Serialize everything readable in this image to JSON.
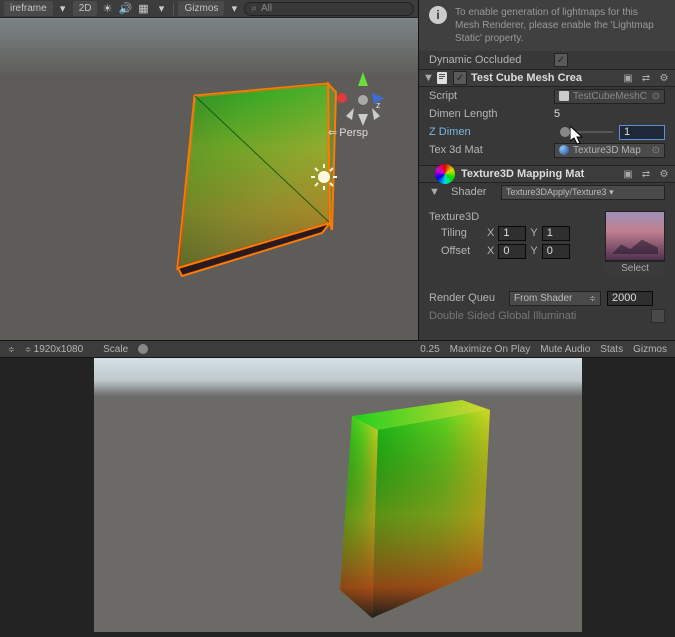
{
  "scene_toolbar": {
    "shading": "ireframe",
    "mode_2d": "2D",
    "gizmos_label": "Gizmos",
    "search_prefix": "All"
  },
  "inspector": {
    "lightmap_info": "To enable generation of lightmaps for this Mesh Renderer, please enable the 'Lightmap Static' property.",
    "dynamic_occluded": {
      "label": "Dynamic Occluded",
      "checked": true
    },
    "script_component": {
      "title": "Test Cube Mesh Crea",
      "enabled": true,
      "fields": {
        "script": {
          "label": "Script",
          "value": "TestCubeMeshC"
        },
        "dimen_length": {
          "label": "Dimen Length",
          "value": "5"
        },
        "z_dimen": {
          "label": "Z Dimen",
          "value": "1"
        },
        "tex_3d_mat": {
          "label": "Tex 3d Mat",
          "value": "Texture3D Map"
        }
      }
    },
    "material": {
      "title": "Texture3D Mapping Mat",
      "shader_label": "Shader",
      "shader_value": "Texture3DApply/Texture3",
      "texture_label": "Texture3D",
      "tiling": {
        "label": "Tiling",
        "x": "1",
        "y": "1"
      },
      "offset": {
        "label": "Offset",
        "x": "0",
        "y": "0"
      },
      "preview_select": "Select"
    },
    "render_queue": {
      "label": "Render Queu",
      "mode": "From Shader",
      "value": "2000"
    },
    "double_sided": {
      "label": "Double Sided Global Illuminati",
      "checked": false
    }
  },
  "scene_overlay": {
    "persp": "Persp"
  },
  "game_toolbar": {
    "resolution": "1920x1080",
    "scale_label": "Scale",
    "scale_value": "0.25",
    "maximize": "Maximize On Play",
    "mute": "Mute Audio",
    "stats": "Stats",
    "gizmos": "Gizmos"
  }
}
